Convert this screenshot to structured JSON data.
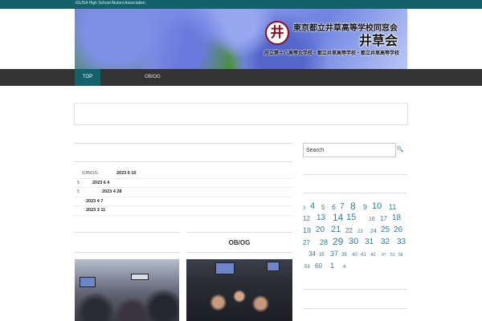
{
  "header": {
    "tagline": "IGUSA High School Alumni Association",
    "banner_title": "東京都立井草高等学校同窓会",
    "banner_logo": "井草会",
    "banner_subtitle": "府立第十八高等女学校・都立井草高等学校・都立井草高等学校",
    "emblem_glyph": "井"
  },
  "nav": {
    "items": [
      {
        "label": "TOP",
        "active": true
      },
      {
        "label": "OB/OG",
        "active": false
      }
    ]
  },
  "news": {
    "items": [
      {
        "category": "(OB/OG",
        "date": "2023 6 10"
      },
      {
        "category": "5",
        "date": "2023 6 4"
      },
      {
        "category": "5",
        "date": "2023 4 28"
      },
      {
        "category": "",
        "date": "2023 4 7"
      },
      {
        "category": "",
        "date": "2023 3 11"
      }
    ]
  },
  "obog": {
    "title": "OB/OG"
  },
  "sidebar": {
    "search_placeholder": "Search",
    "calendar_rows": [
      [
        "3",
        "4",
        "5",
        "6",
        "7",
        "8",
        "9",
        "10",
        "11"
      ],
      [
        "12",
        "13",
        "14",
        "15",
        "16",
        "17",
        "18"
      ],
      [
        "19",
        "20",
        "21",
        "22",
        "23",
        "24",
        "25",
        "26"
      ],
      [
        "27",
        "28",
        "29",
        "30",
        "31",
        "32",
        "33"
      ],
      [
        "34",
        "35",
        "37",
        "38",
        "40",
        "41",
        "42",
        "47",
        "51",
        "58"
      ],
      [
        "59",
        "60",
        "1",
        "4"
      ]
    ]
  },
  "colors": {
    "accent": "#13626b",
    "nav_bg": "#333333",
    "link": "#2e7f9c"
  }
}
